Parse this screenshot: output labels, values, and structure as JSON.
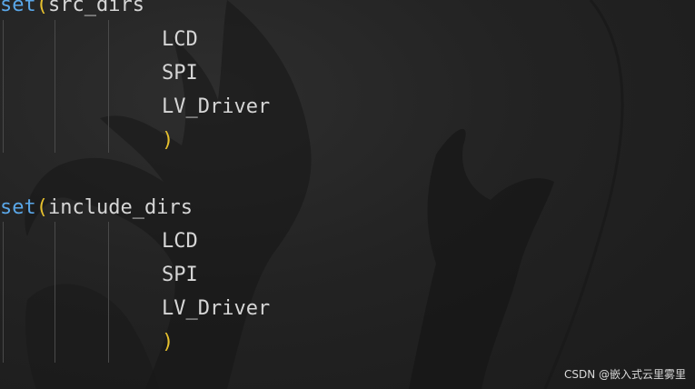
{
  "code": {
    "block1": {
      "keyword": "set",
      "open_paren": "(",
      "name": "src_dirs",
      "items": [
        "LCD",
        "SPI",
        "LV_Driver"
      ],
      "close_paren": ")"
    },
    "block2": {
      "keyword": "set",
      "open_paren": "(",
      "name": "include_dirs",
      "items": [
        "LCD",
        "SPI",
        "LV_Driver"
      ],
      "close_paren": ")"
    }
  },
  "watermark": "CSDN @嵌入式云里雾里",
  "colors": {
    "keyword": "#5aa7e8",
    "paren": "#e6c02e",
    "identifier": "#d6d6d6",
    "background": "#1f1f1f"
  }
}
